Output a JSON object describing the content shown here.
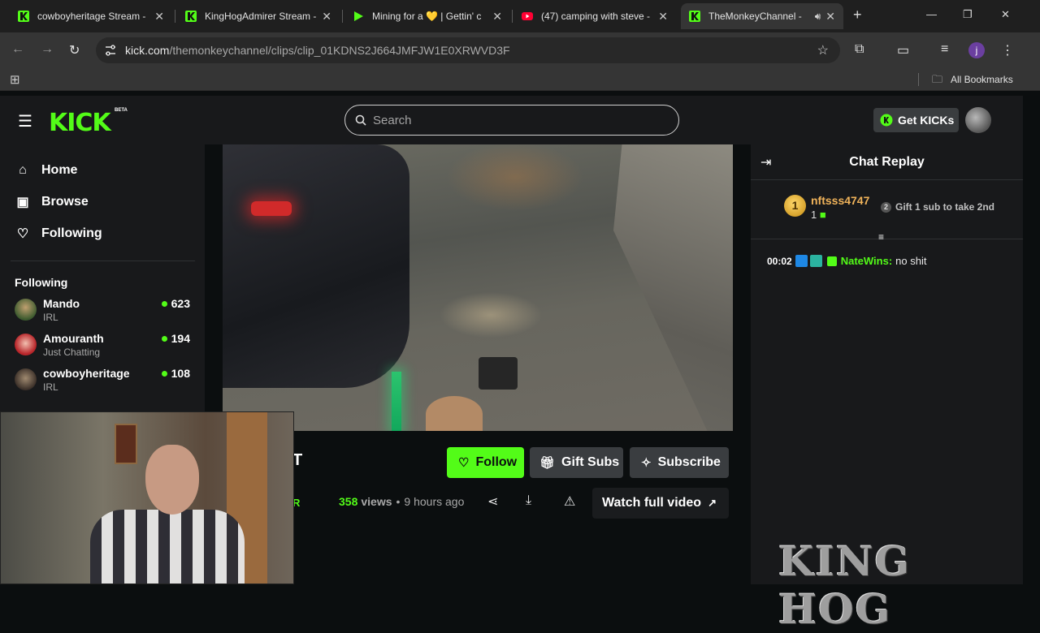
{
  "browser": {
    "tabs": [
      {
        "title": "cowboyheritage Stream - ",
        "active": false
      },
      {
        "title": "KingHogAdmirer Stream - ",
        "active": false
      },
      {
        "title": "Mining for a 💛 | Gettin' c",
        "active": false
      },
      {
        "title": "(47) camping with steve - ",
        "active": false
      },
      {
        "title": "TheMonkeyChannel - ",
        "active": true
      }
    ],
    "url_host": "kick.com",
    "url_path": "/themonkeychannel/clips/clip_01KDNS2J664JMFJW1E0XRWVD3F",
    "bookmarks_label": "All Bookmarks",
    "profile_initial": "j"
  },
  "kick": {
    "logo": "KICK",
    "beta": "BETA",
    "search_placeholder": "Search",
    "get_kicks": "Get KICKs",
    "nav": [
      {
        "label": "Home",
        "icon": "home-icon"
      },
      {
        "label": "Browse",
        "icon": "browse-icon"
      },
      {
        "label": "Following",
        "icon": "heart-icon"
      }
    ],
    "following_header": "Following",
    "following": [
      {
        "name": "Mando",
        "category": "IRL",
        "viewers": "623"
      },
      {
        "name": "Amouranth",
        "category": "Just Chatting",
        "viewers": "194"
      },
      {
        "name": "cowboyheritage",
        "category": "IRL",
        "viewers": "108"
      }
    ]
  },
  "clip": {
    "follow": "Follow",
    "gift_subs": "Gift Subs",
    "subscribe": "Subscribe",
    "views": "358",
    "views_label": "views",
    "time_ago": "9 hours ago",
    "watch_full": "Watch full video",
    "partial_title": "T",
    "partial_meta": "R"
  },
  "chat": {
    "title": "Chat Replay",
    "pinned": {
      "rank": "1",
      "username": "nftsss4747",
      "count": "1",
      "gift_rank": "2",
      "gift_text": "Gift 1 sub to take 2nd"
    },
    "messages": [
      {
        "time": "00:02",
        "username": "NateWins:",
        "text": "no shit"
      }
    ]
  },
  "overlay": {
    "watermark": "KING HOG"
  },
  "colors": {
    "kick_green": "#53fc18",
    "bg": "#0b0e0f",
    "panel": "#18191b"
  }
}
